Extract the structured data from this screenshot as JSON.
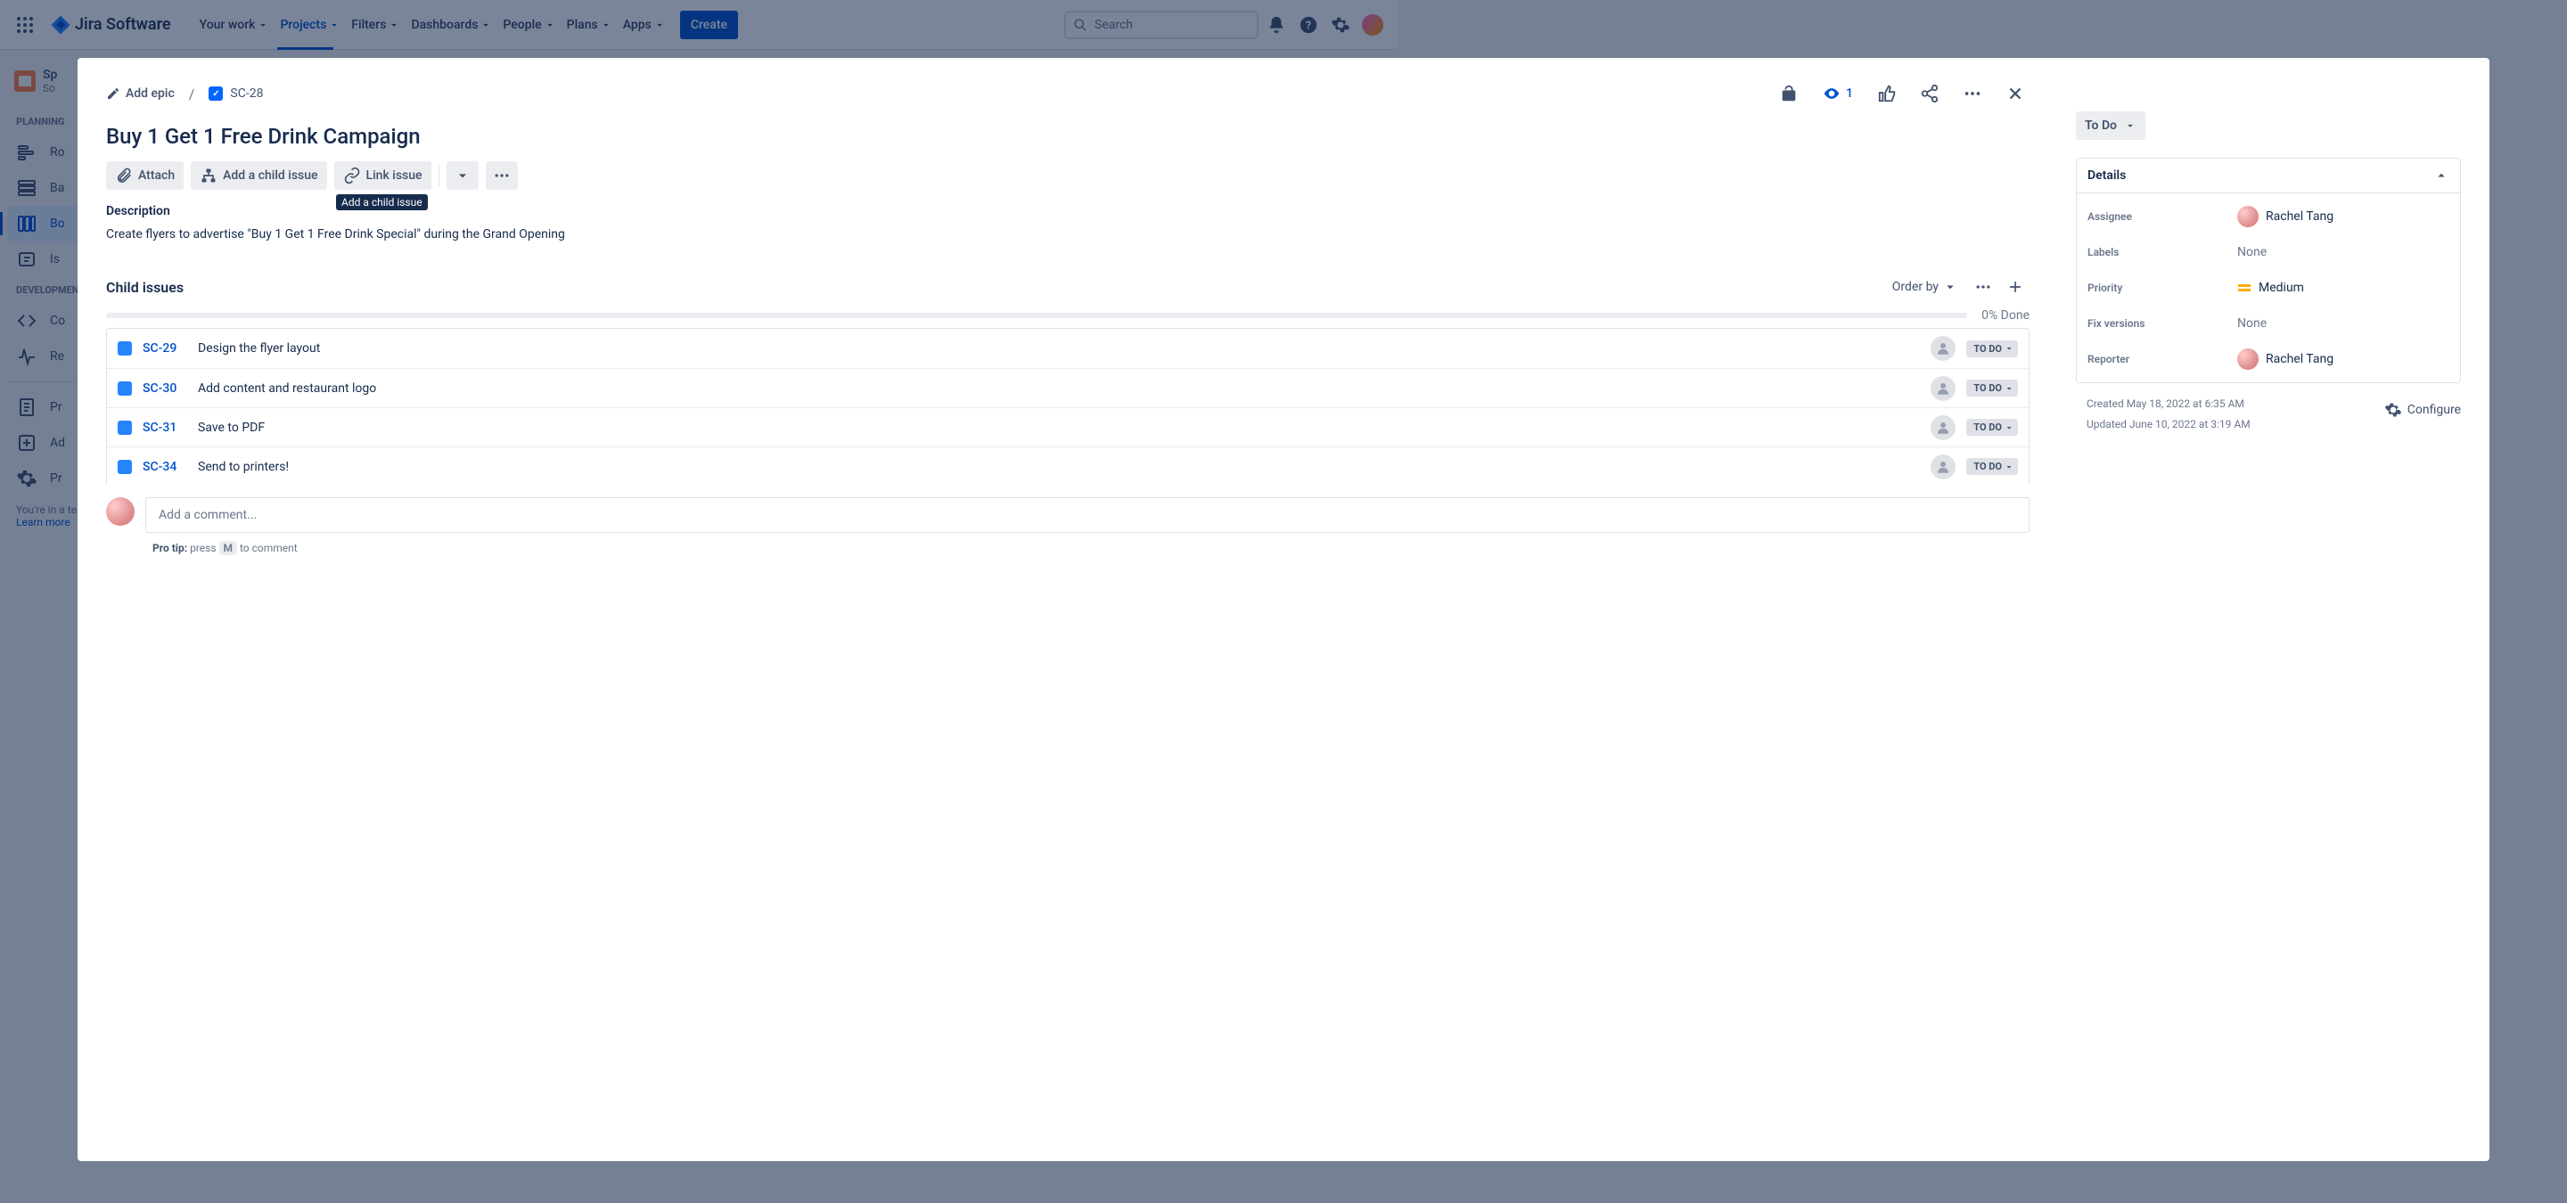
{
  "nav": {
    "logo": "Jira Software",
    "items": [
      "Your work",
      "Projects",
      "Filters",
      "Dashboards",
      "People",
      "Plans",
      "Apps"
    ],
    "activeIndex": 1,
    "create": "Create",
    "searchPlaceholder": "Search"
  },
  "sidebar": {
    "projectName": "Sp",
    "projectSub": "So",
    "sections": [
      {
        "label": "Planning",
        "items": [
          {
            "label": "Ro",
            "icon": "roadmap"
          },
          {
            "label": "Ba",
            "icon": "backlog"
          },
          {
            "label": "Bo",
            "icon": "board",
            "active": true
          },
          {
            "label": "Is",
            "icon": "issues"
          }
        ]
      },
      {
        "label": "Development",
        "items": [
          {
            "label": "Co",
            "icon": "code"
          },
          {
            "label": "Re",
            "icon": "releases"
          }
        ]
      }
    ],
    "bottom": [
      {
        "label": "Pr",
        "icon": "pages"
      },
      {
        "label": "Ad",
        "icon": "add"
      },
      {
        "label": "Pr",
        "icon": "settings"
      }
    ],
    "footer": "You're in a team-managed project",
    "learn": "Learn more"
  },
  "issue": {
    "addEpic": "Add epic",
    "key": "SC-28",
    "title": "Buy 1 Get 1 Free Drink Campaign",
    "actions": {
      "attach": "Attach",
      "addChild": "Add a child issue",
      "linkIssue": "Link issue",
      "tooltip": "Add a child issue"
    },
    "descLabel": "Description",
    "description": "Create flyers to advertise \"Buy 1 Get 1 Free Drink Special\" during the Grand Opening",
    "childLabel": "Child issues",
    "orderBy": "Order by",
    "progressLabel": "0% Done",
    "children": [
      {
        "key": "SC-29",
        "summary": "Design the flyer layout",
        "status": "TO DO"
      },
      {
        "key": "SC-30",
        "summary": "Add content and restaurant logo",
        "status": "TO DO"
      },
      {
        "key": "SC-31",
        "summary": "Save to PDF",
        "status": "TO DO"
      },
      {
        "key": "SC-34",
        "summary": "Send to printers!",
        "status": "TO DO"
      }
    ],
    "commentPlaceholder": "Add a comment...",
    "protip": {
      "bold": "Pro tip:",
      "press": "press",
      "key": "M",
      "rest": "to comment"
    },
    "watchers": "1"
  },
  "side": {
    "status": "To Do",
    "detailsLabel": "Details",
    "fields": {
      "assigneeLabel": "Assignee",
      "assignee": "Rachel Tang",
      "labelsLabel": "Labels",
      "labels": "None",
      "priorityLabel": "Priority",
      "priority": "Medium",
      "fixLabel": "Fix versions",
      "fix": "None",
      "reporterLabel": "Reporter",
      "reporter": "Rachel Tang"
    },
    "created": "Created May 18, 2022 at 6:35 AM",
    "updated": "Updated June 10, 2022 at 3:19 AM",
    "configure": "Configure"
  }
}
